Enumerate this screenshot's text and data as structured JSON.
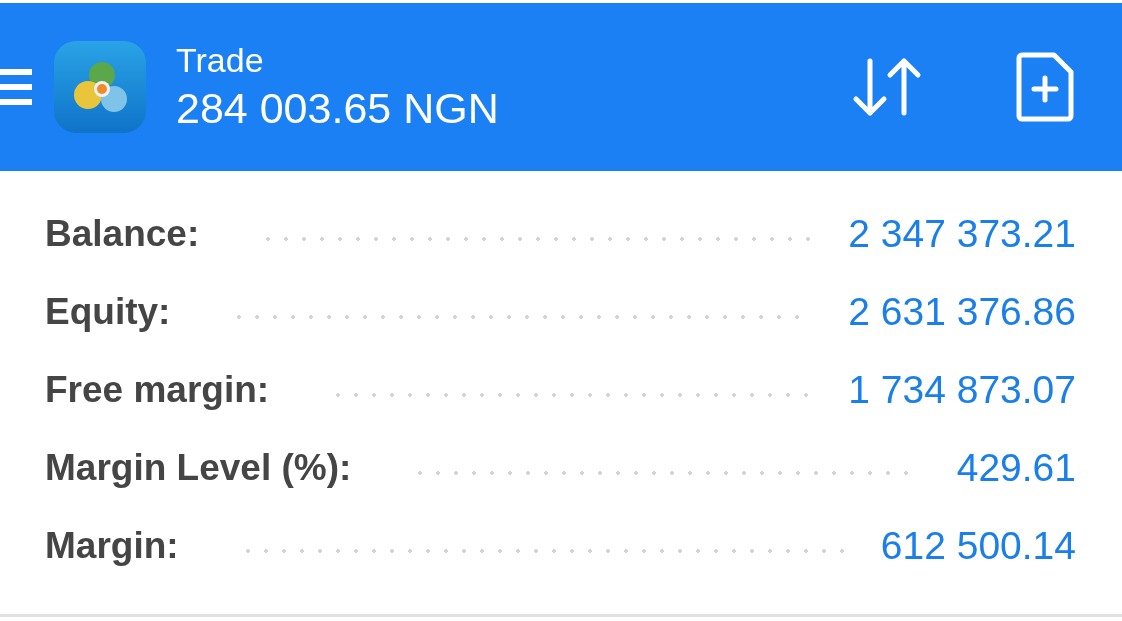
{
  "header": {
    "title": "Trade",
    "subtitle": "284 003.65 NGN"
  },
  "rows": [
    {
      "label": "Balance:",
      "value": "2 347 373.21"
    },
    {
      "label": "Equity:",
      "value": "2 631 376.86"
    },
    {
      "label": "Free margin:",
      "value": "1 734 873.07"
    },
    {
      "label": "Margin Level (%):",
      "value": "429.61"
    },
    {
      "label": "Margin:",
      "value": "612 500.14"
    }
  ]
}
